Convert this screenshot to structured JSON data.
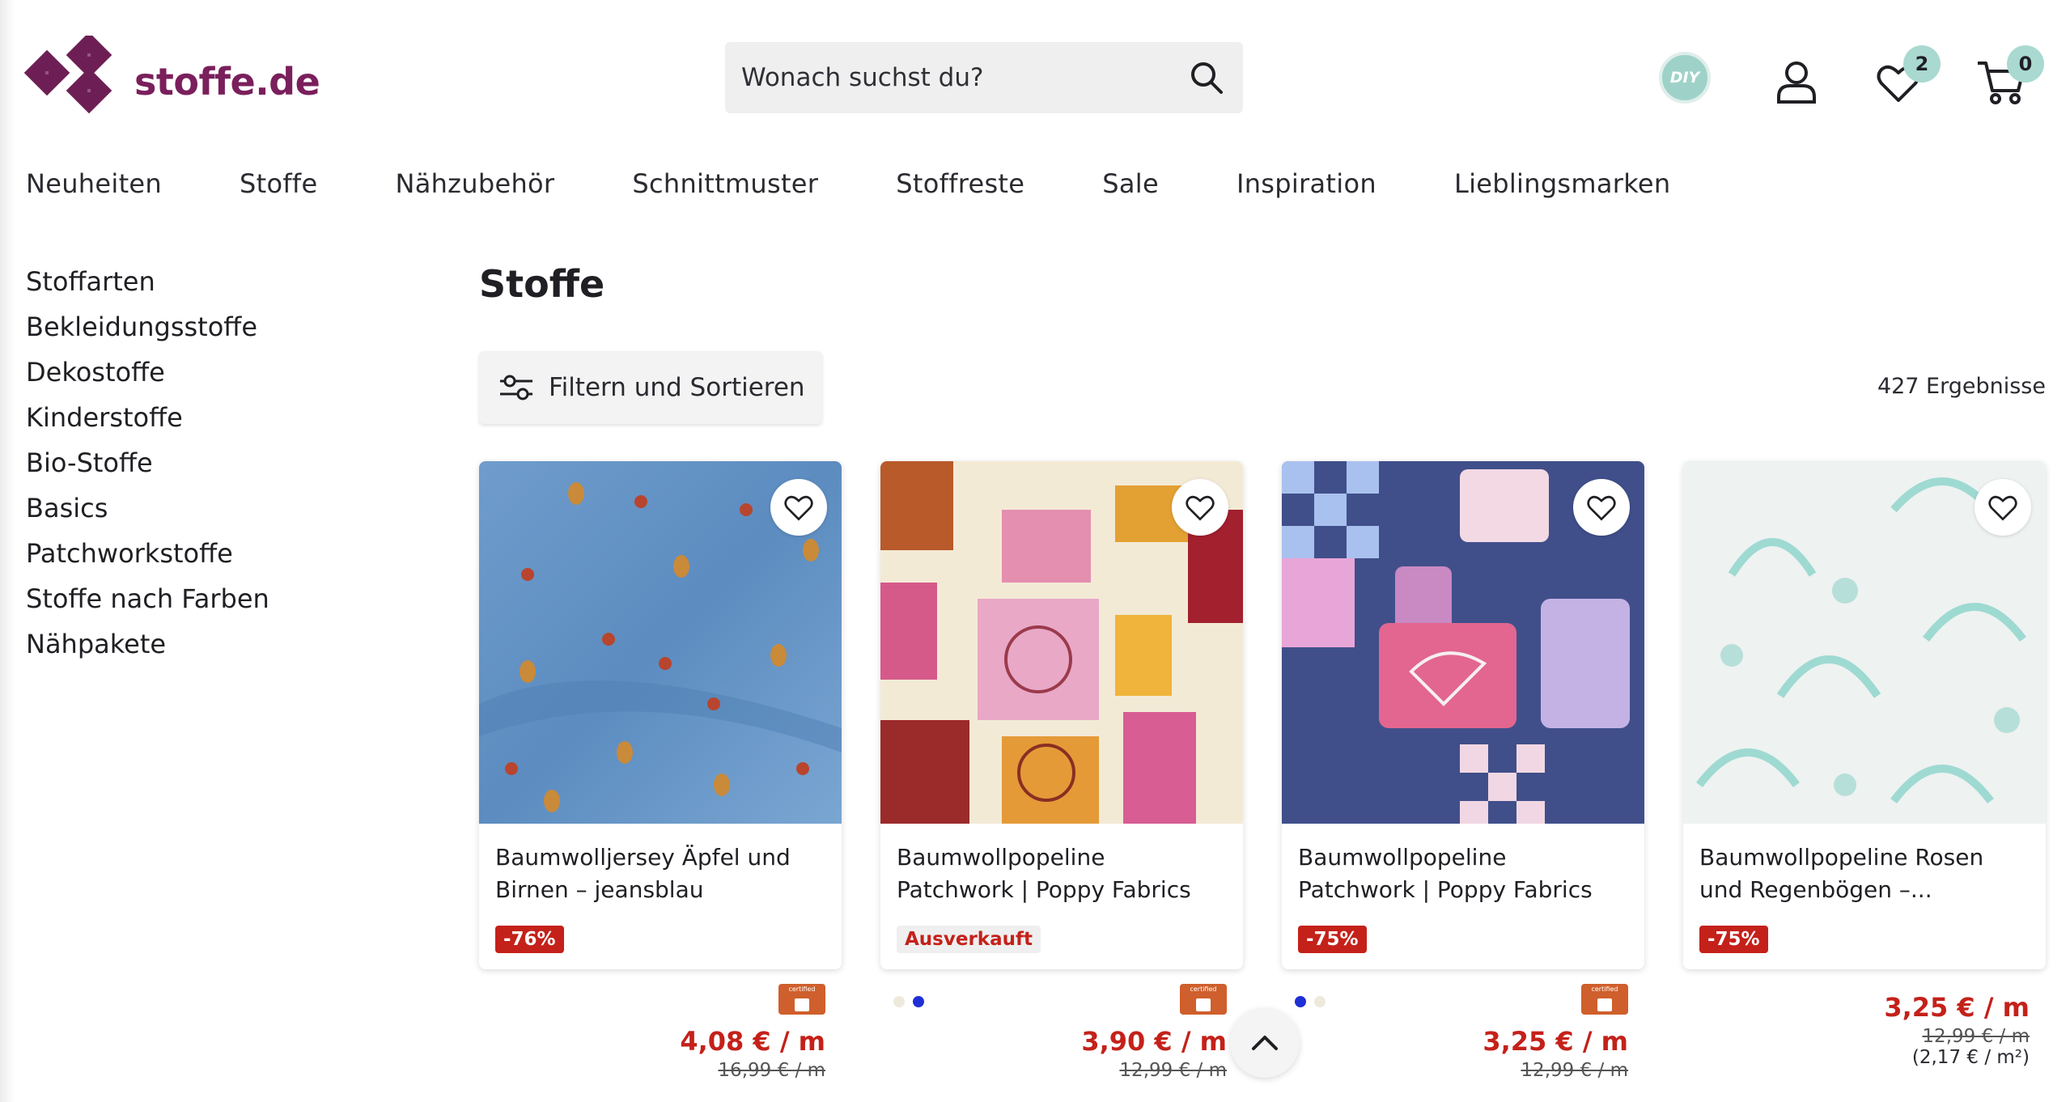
{
  "brand": {
    "name": "stoffe.de",
    "color": "#7a1f5c"
  },
  "search": {
    "placeholder": "Wonach suchst du?",
    "icon": "search-icon"
  },
  "header_icons": {
    "diy_badge": "DIY",
    "wishlist_count": "2",
    "cart_count": "0"
  },
  "main_nav": [
    "Neuheiten",
    "Stoffe",
    "Nähzubehör",
    "Schnittmuster",
    "Stoffreste",
    "Sale",
    "Inspiration",
    "Lieblingsmarken"
  ],
  "sidebar": [
    "Stoffarten",
    "Bekleidungsstoffe",
    "Dekostoffe",
    "Kinderstoffe",
    "Bio-Stoffe",
    "Basics",
    "Patchworkstoffe",
    "Stoffe nach Farben",
    "Nähpakete"
  ],
  "page": {
    "title": "Stoffe",
    "filter_label": "Filtern und Sortieren",
    "result_count": "427 Ergebnisse"
  },
  "certified_label": "certified",
  "products": [
    {
      "title": "Baumwolljersey Äpfel und Birnen – jeansblau",
      "badge": "-76%",
      "price": "4,08 € / m",
      "old_price": "16,99 € / m",
      "swatches": []
    },
    {
      "title": "Baumwollpopeline Patchwork | Poppy Fabrics –...",
      "badge": "Ausverkauft",
      "price": "3,90 € / m",
      "old_price": "12,99 € / m",
      "swatches": [
        "#eeeadb",
        "#1f2fd6"
      ]
    },
    {
      "title": "Baumwollpopeline Patchwork | Poppy Fabrics –...",
      "badge": "-75%",
      "price": "3,25 € / m",
      "old_price": "12,99 € / m",
      "swatches": [
        "#1f2fd6",
        "#eeeadb"
      ]
    },
    {
      "title": "Baumwollpopeline Rosen und Regenbögen –...",
      "badge": "-75%",
      "price": "3,25 € / m",
      "old_price": "12,99 € / m",
      "unit_price": "(2,17 € / m²)",
      "swatches": []
    }
  ],
  "colors": {
    "sale_red": "#c4211a",
    "badge_teal": "#a9d9d0"
  }
}
